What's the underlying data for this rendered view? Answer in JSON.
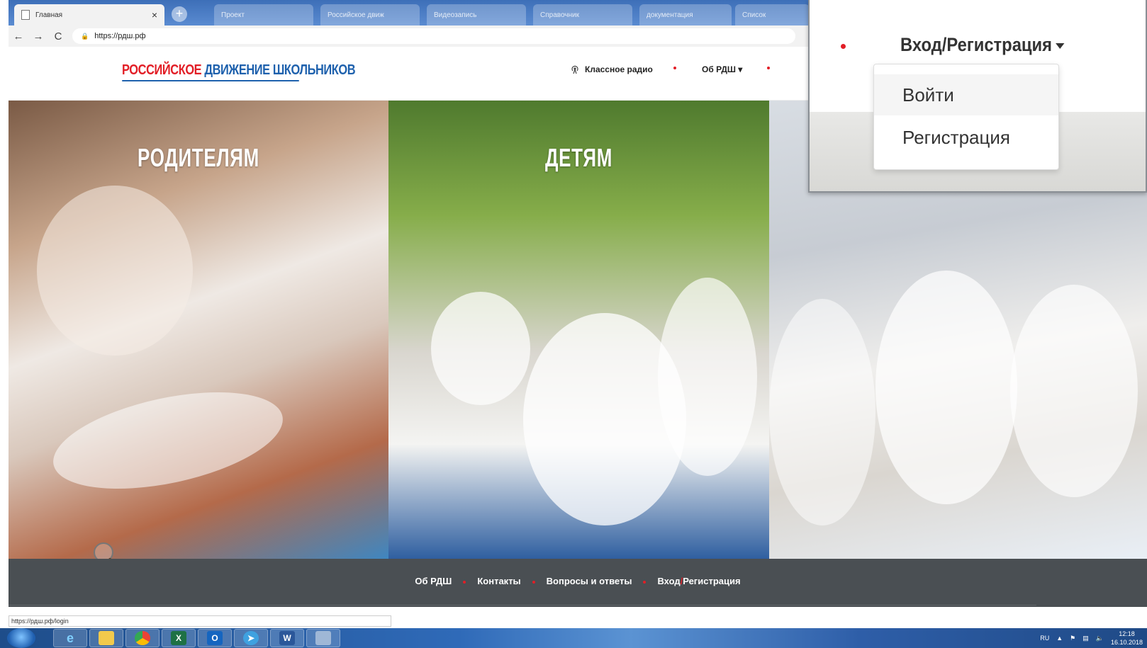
{
  "browser": {
    "active_tab_title": "Главная",
    "tab_close_glyph": "×",
    "new_tab_glyph": "+",
    "inactive_tabs": [
      "Проект",
      "Российское движ",
      "Видеозапись",
      "Справочник",
      "документация",
      "Список"
    ],
    "url": "https://рдш.рф",
    "back_glyph": "←",
    "forward_glyph": "→",
    "reload_glyph": "C"
  },
  "header": {
    "logo_part1": "РОССИЙСКОЕ",
    "logo_part2": "ДВИЖЕНИЕ ШКОЛЬНИКОВ",
    "radio_label": "Классное радио",
    "about_label": "Об РДШ"
  },
  "hero": {
    "parents_title": "РОДИТЕЛЯМ",
    "kids_title": "ДЕТЯМ"
  },
  "footer": {
    "links": [
      "Об РДШ",
      "Контакты",
      "Вопросы и ответы"
    ],
    "login_part1": "Вход",
    "login_slash": "/",
    "login_part2": "Регистрация"
  },
  "status_bar_url": "https://рдш.рф/login",
  "zoom": {
    "login_menu_label": "Вход/Регистрация",
    "dropdown": {
      "login": "Войти",
      "register": "Регистрация"
    }
  },
  "taskbar": {
    "apps": [
      "ie-icon",
      "explorer-icon",
      "chrome-icon",
      "excel-icon",
      "outlook-icon",
      "telegram-icon",
      "word-icon",
      "network-icon"
    ],
    "excel_glyph": "X",
    "outlook_glyph": "O",
    "word_glyph": "W",
    "lang": "RU",
    "time": "12:18",
    "date": "16.10.2018"
  },
  "colors": {
    "brand_red": "#e21e26",
    "brand_blue": "#1e61ad",
    "footer_bg": "#4a4f53"
  }
}
